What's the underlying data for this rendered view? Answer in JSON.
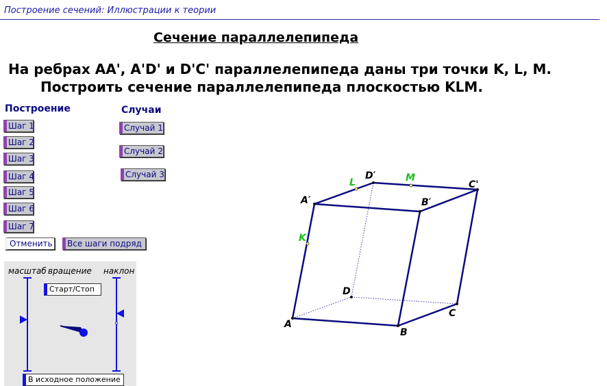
{
  "header": {
    "title": "Построение сечений: Иллюстрации к теории"
  },
  "main": {
    "title": "Сечение параллелепипеда ",
    "problem_line1": "На ребрах AA', A'D' и D'C' параллелепипеда даны три точки K, L, M.",
    "problem_line2": "Построить сечение параллелепипеда плоскостью KLM."
  },
  "construction": {
    "heading": "Построение",
    "steps": [
      "Шаг 1",
      "Шаг 2",
      "Шаг 3",
      "Шаг 4",
      "Шаг 5",
      "Шаг 6",
      "Шаг 7"
    ],
    "cancel_label": "Отменить",
    "all_steps_label": "Все шаги подряд"
  },
  "cases": {
    "heading": "Случаи",
    "items": [
      "Случай 1",
      "Случай 2",
      "Случай 3"
    ]
  },
  "control_panel": {
    "scale_label": "масштаб",
    "rotation_label": "вращение",
    "tilt_label": "наклон",
    "start_stop_label": "Старт/Стоп",
    "reset_label": "В исходное положение"
  },
  "figure": {
    "vertex_labels": {
      "A": "A",
      "B": "B",
      "C": "C",
      "D": "D",
      "A1": "A′",
      "B1": "B′",
      "C1": "C'",
      "D1": "D′"
    },
    "point_labels": {
      "K": "K",
      "L": "L",
      "M": "M"
    },
    "colors": {
      "edge": "#0a0a80",
      "points": "#19c019",
      "hidden": "#2222aa"
    }
  }
}
